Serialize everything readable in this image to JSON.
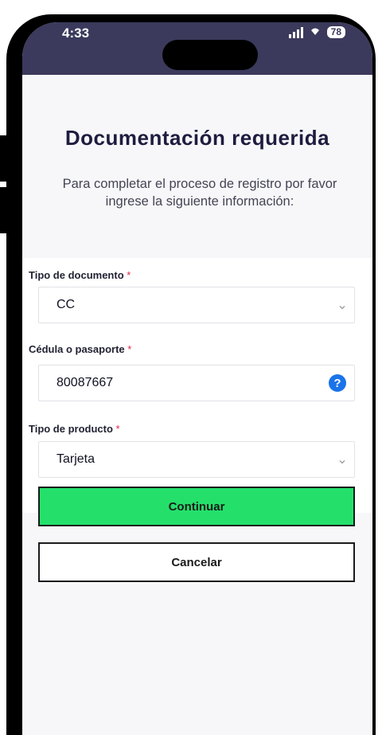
{
  "status_bar": {
    "time": "4:33",
    "battery": "78"
  },
  "header": {
    "title": "Documentación requerida",
    "subtitle": "Para completar el proceso de registro por favor ingrese la siguiente información:"
  },
  "form": {
    "document_type": {
      "label": "Tipo de documento",
      "required_mark": "*",
      "value": "CC",
      "icon": "chevron-down-icon"
    },
    "id_number": {
      "label": "Cédula o pasaporte",
      "required_mark": "*",
      "value": "80087667",
      "help_symbol": "?",
      "icon": "help-icon"
    },
    "product_type": {
      "label": "Tipo de producto",
      "required_mark": "*",
      "value": "Tarjeta",
      "icon": "chevron-down-icon"
    }
  },
  "actions": {
    "continue_label": "Continuar",
    "cancel_label": "Cancelar"
  },
  "colors": {
    "primary_button": "#24e06b",
    "status_bar": "#3b3a5c",
    "title": "#1e1c3f",
    "required": "#e0264e",
    "help_icon": "#1a73e8"
  }
}
